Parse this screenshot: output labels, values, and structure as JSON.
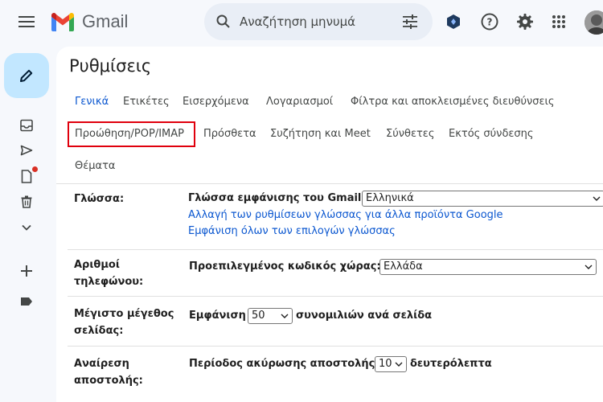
{
  "app": {
    "name": "Gmail"
  },
  "search": {
    "placeholder": "Αναζήτηση μηνυμά"
  },
  "settings": {
    "title": "Ρυθμίσεις",
    "tabs": [
      {
        "label": "Γενικά",
        "active": true
      },
      {
        "label": "Ετικέτες"
      },
      {
        "label": "Εισερχόμενα"
      },
      {
        "label": "Λογαριασμοί"
      },
      {
        "label": "Φίλτρα και αποκλεισμένες διευθύνσεις"
      },
      {
        "label": "Προώθηση/POP/IMAP",
        "highlighted": true
      },
      {
        "label": "Πρόσθετα"
      },
      {
        "label": "Συζήτηση και Meet"
      },
      {
        "label": "Σύνθετες"
      },
      {
        "label": "Εκτός σύνδεσης"
      },
      {
        "label": "Θέματα"
      }
    ],
    "rows": [
      {
        "label": "Γλώσσα:",
        "field_label": "Γλώσσα εμφάνισης του Gmail:",
        "select_value": "Ελληνικά",
        "links": [
          "Αλλαγή των ρυθμίσεων γλώσσας για άλλα προϊόντα Google",
          "Εμφάνιση όλων των επιλογών γλώσσας"
        ]
      },
      {
        "label": "Αριθμοί τηλεφώνου:",
        "field_label": "Προεπιλεγμένος κωδικός χώρας:",
        "select_value": "Ελλάδα"
      },
      {
        "label": "Μέγιστο μέγεθος σελίδας:",
        "prefix": "Εμφάνιση",
        "select_value": "50",
        "suffix": "συνομιλιών ανά σελίδα"
      },
      {
        "label": "Αναίρεση αποστολής:",
        "field_label": "Περίοδος ακύρωσης αποστολής:",
        "select_value": "10",
        "suffix": "δευτερόλεπτα"
      }
    ]
  },
  "colors": {
    "accent": "#0b57d0",
    "highlight_border": "#e0000d",
    "compose_bg": "#c2e7ff",
    "notification_dot": "#d93025"
  }
}
